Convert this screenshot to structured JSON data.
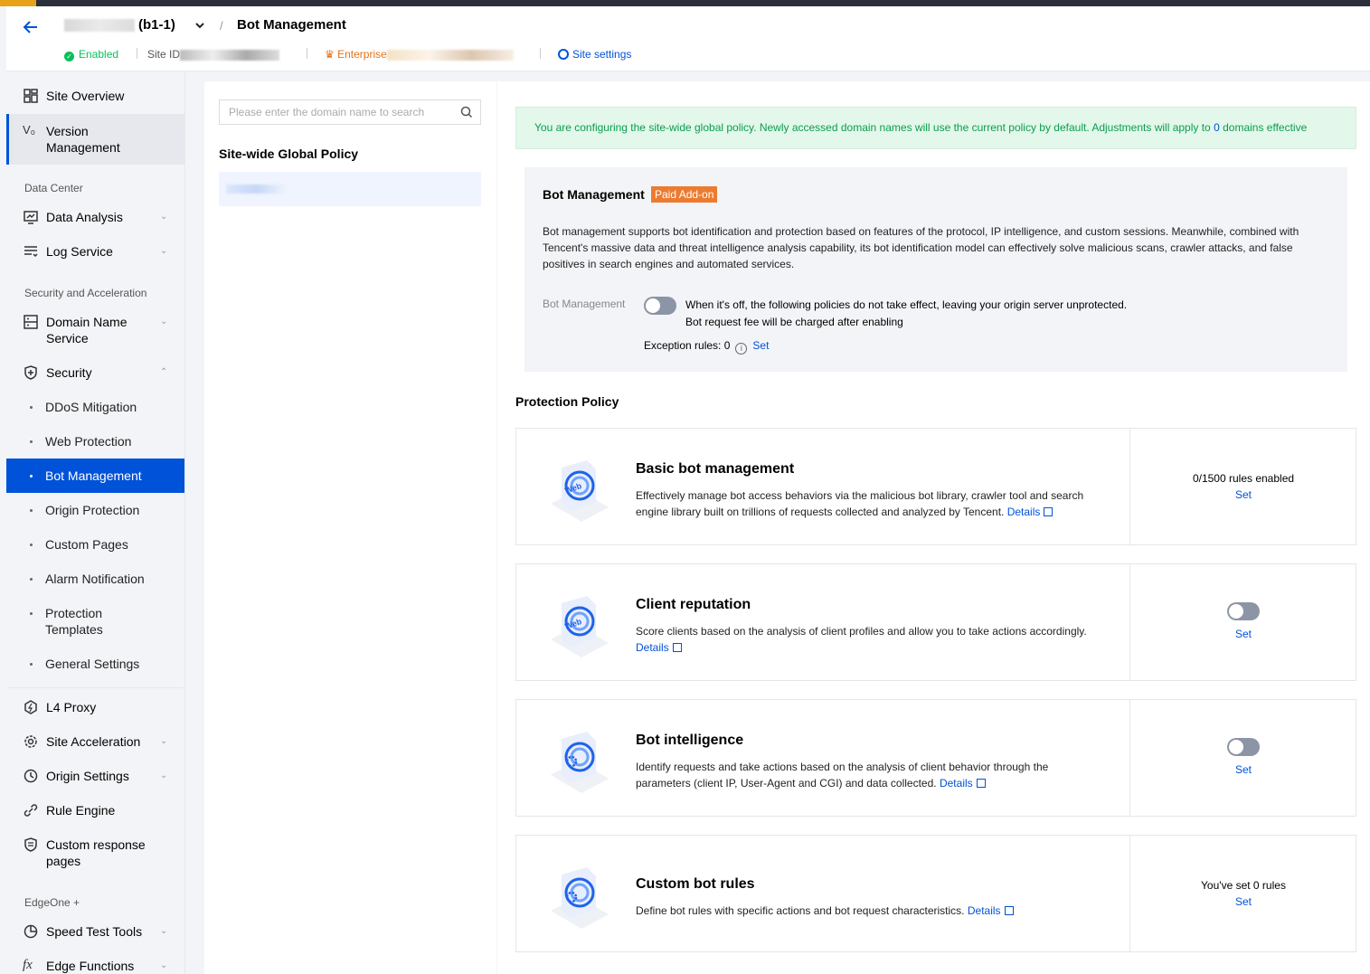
{
  "header": {
    "site_name_suffix": "(b1-1)",
    "crumb_separator": "/",
    "page_title": "Bot Management",
    "status": "Enabled",
    "site_id_label": "Site ID",
    "plan_label": "Enterprise",
    "site_settings": "Site settings"
  },
  "sidebar": {
    "items": {
      "site_overview": "Site Overview",
      "version_management_1": "Version",
      "version_management_2": "Management",
      "group_data_center": "Data Center",
      "data_analysis": "Data Analysis",
      "log_service": "Log Service",
      "group_security": "Security and Acceleration",
      "dns_1": "Domain Name",
      "dns_2": "Service",
      "security": "Security",
      "ddos": "DDoS Mitigation",
      "web_protection": "Web Protection",
      "bot_management": "Bot Management",
      "origin_protection": "Origin Protection",
      "custom_pages": "Custom Pages",
      "alarm_notification": "Alarm Notification",
      "protection_templates_1": "Protection",
      "protection_templates_2": "Templates",
      "general_settings": "General Settings",
      "l4_proxy": "L4 Proxy",
      "site_acceleration": "Site Acceleration",
      "origin_settings": "Origin Settings",
      "rule_engine": "Rule Engine",
      "custom_response_1": "Custom response",
      "custom_response_2": "pages",
      "group_edgeone": "EdgeOne +",
      "speed_test": "Speed Test Tools",
      "edge_functions": "Edge Functions"
    }
  },
  "domain_panel": {
    "search_placeholder": "Please enter the domain name to search",
    "global_policy_title": "Site-wide Global Policy"
  },
  "main": {
    "notice_text": "You are configuring the site-wide global policy. Newly accessed domain names will use the current policy by default. Adjustments will apply to",
    "notice_count": "0",
    "notice_tail": "domains effective",
    "bot": {
      "title": "Bot Management",
      "badge": "Paid Add-on",
      "description": "Bot management supports bot identification and protection based on features of the protocol, IP intelligence, and custom sessions. Meanwhile, combined with Tencent's massive data and threat intelligence analysis capability, its bot identification model can effectively solve malicious scans, crawler attacks, and false positives in search engines and automated services.",
      "toggle_label": "Bot Management",
      "toggle_on": false,
      "hint1": "When it's off, the following policies do not take effect, leaving your origin server unprotected.",
      "hint2": "Bot request fee will be charged after enabling",
      "exception_label": "Exception rules: 0",
      "set": "Set"
    },
    "protection_policy_title": "Protection Policy",
    "policies": [
      {
        "title": "Basic bot management",
        "description": "Effectively manage bot access behaviors via the malicious bot library, crawler tool and search engine library built on trillions of requests collected and analyzed by Tencent.",
        "details": "Details",
        "status": "0/1500 rules enabled",
        "set": "Set"
      },
      {
        "title": "Client reputation",
        "description": "Score clients based on the analysis of client profiles and allow you to take actions accordingly.",
        "details": "Details",
        "toggle_on": false,
        "set": "Set"
      },
      {
        "title": "Bot intelligence",
        "description": "Identify requests and take actions based on the analysis of client behavior through the parameters (client IP, User-Agent and CGI) and data collected.",
        "details": "Details",
        "toggle_on": false,
        "set": "Set"
      },
      {
        "title": "Custom bot rules",
        "description": "Define bot rules with specific actions and bot request characteristics.",
        "details": "Details",
        "status": "You've set 0 rules",
        "set": "Set"
      }
    ]
  },
  "colors": {
    "primary": "#0052d9",
    "success": "#0abf5b",
    "warning": "#ed7b2f",
    "toggle_off": "#8c95a6"
  }
}
